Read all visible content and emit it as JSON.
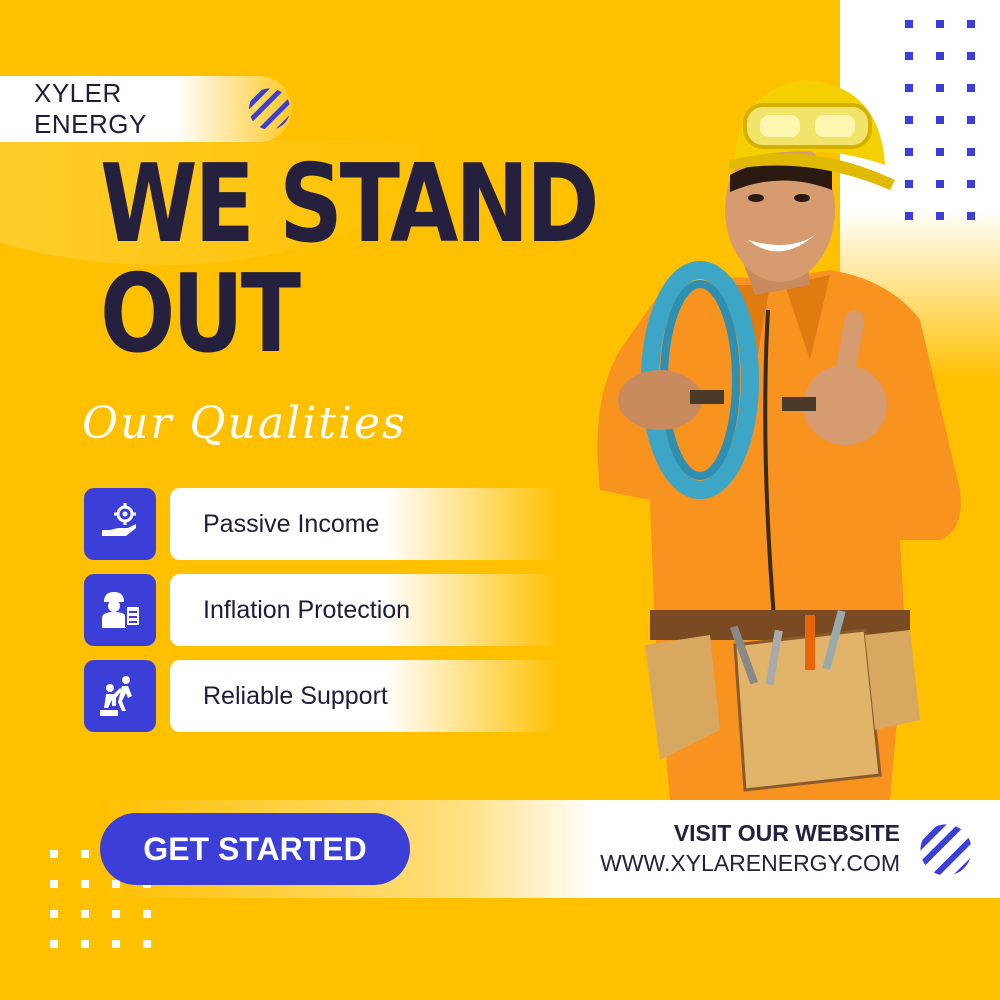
{
  "brand": {
    "name": "XYLER ENERGY",
    "logo_icon": "striped-circle-logo"
  },
  "headline": {
    "line1": "WE STAND",
    "line2": "OUT"
  },
  "subtitle": "Our Qualities",
  "qualities": [
    {
      "label": "Passive Income",
      "icon": "hand-gear-icon"
    },
    {
      "label": "Inflation Protection",
      "icon": "worker-clipboard-icon"
    },
    {
      "label": "Reliable Support",
      "icon": "helping-hand-icon"
    }
  ],
  "cta": {
    "label": "GET STARTED"
  },
  "website": {
    "heading": "VISIT OUR WEBSITE",
    "url": "WWW.XYLARENERGY.COM"
  },
  "colors": {
    "background": "#FFC000",
    "accent": "#3B3FD8",
    "headline": "#26203F",
    "white": "#FFFFFF"
  }
}
